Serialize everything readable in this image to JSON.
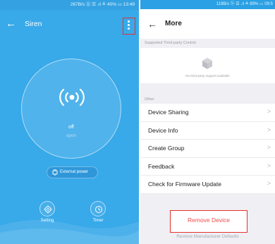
{
  "left_screen": {
    "status_text": "267B/s ⓑ ☰ .ıl ≛ 40% ▭ 13:49",
    "title": "Siren",
    "state": "off",
    "substate": "open",
    "power_label": "External power",
    "buttons": {
      "setting": "Setting",
      "timer": "Timer"
    },
    "highlight_color": "#e5312f",
    "background_color": "#38a9e9"
  },
  "right_screen": {
    "status_text": "119B/s ⓑ ☰ .ıl ≛ 89% ▭ 09:5",
    "title": "More",
    "third_party_header": "Supported Third-party Control",
    "no_support_text": "No third-party support available",
    "other_header": "Other",
    "menu_items": [
      {
        "label": "Device Sharing",
        "chevron": ">"
      },
      {
        "label": "Device Info",
        "chevron": ">"
      },
      {
        "label": "Create Group",
        "chevron": ">"
      },
      {
        "label": "Feedback",
        "chevron": ">"
      },
      {
        "label": "Check for Firmware Update",
        "chevron": ">"
      }
    ],
    "remove_label": "Remove Device",
    "restore_label": "Restore Manufacturer Defaults",
    "danger_color": "#f04c4c"
  }
}
